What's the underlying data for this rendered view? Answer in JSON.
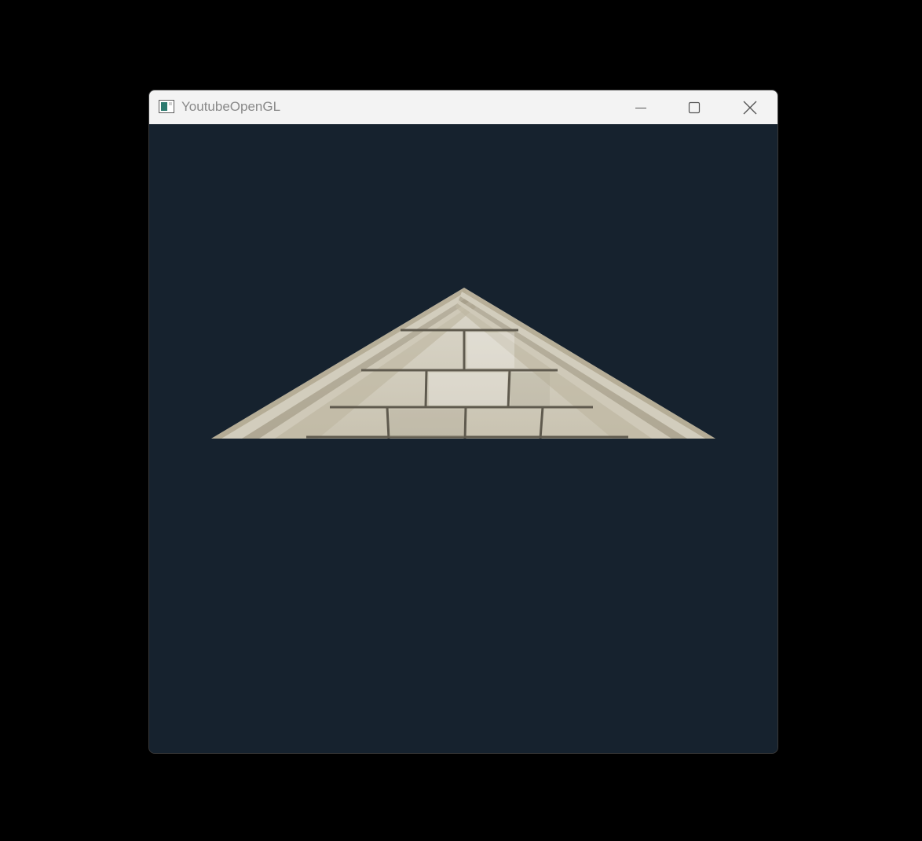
{
  "window": {
    "title": "YoutubeOpenGL",
    "buttons": {
      "minimize": "minimize-icon",
      "maximize": "maximize-icon",
      "close": "close-icon"
    }
  },
  "scene": {
    "background_color": "#16222e",
    "object": "textured-triangle",
    "texture": "stone-brick"
  }
}
